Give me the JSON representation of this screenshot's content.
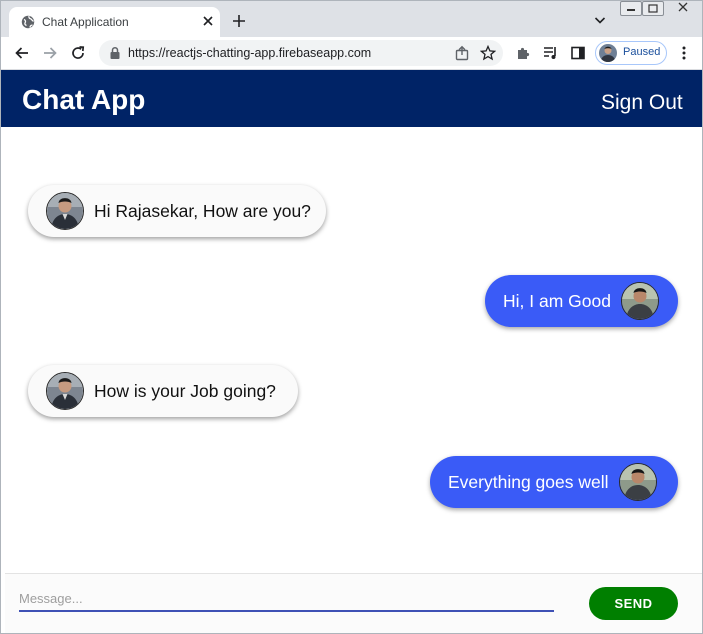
{
  "browser": {
    "tab_title": "Chat Application",
    "url": "https://reactjs-chatting-app.firebaseapp.com",
    "profile_status": "Paused"
  },
  "icons": {
    "tab": "globe-icon",
    "tab_close": "close-icon",
    "new_tab": "plus-icon",
    "back": "back-arrow-icon",
    "forward": "forward-arrow-icon",
    "reload": "reload-icon",
    "lock": "lock-icon",
    "share": "share-icon",
    "bookmark": "star-icon",
    "extensions": "puzzle-icon",
    "media": "media-queue-icon",
    "side_panel": "side-panel-icon",
    "menu": "kebab-menu-icon"
  },
  "app": {
    "title": "Chat App",
    "sign_out": "Sign Out"
  },
  "messages": [
    {
      "text": "Hi Rajasekar, How are you?",
      "direction": "received"
    },
    {
      "text": "Hi, I am Good",
      "direction": "sent"
    },
    {
      "text": "How is your Job going?",
      "direction": "received"
    },
    {
      "text": "Everything goes well",
      "direction": "sent"
    }
  ],
  "composer": {
    "placeholder": "Message...",
    "value": "",
    "send_label": "SEND"
  },
  "colors": {
    "header_bg": "#002366",
    "sent_bubble": "#3a5bf7",
    "received_bubble": "#fafafa",
    "send_button": "#007f00",
    "input_underline": "#3f51b5"
  }
}
